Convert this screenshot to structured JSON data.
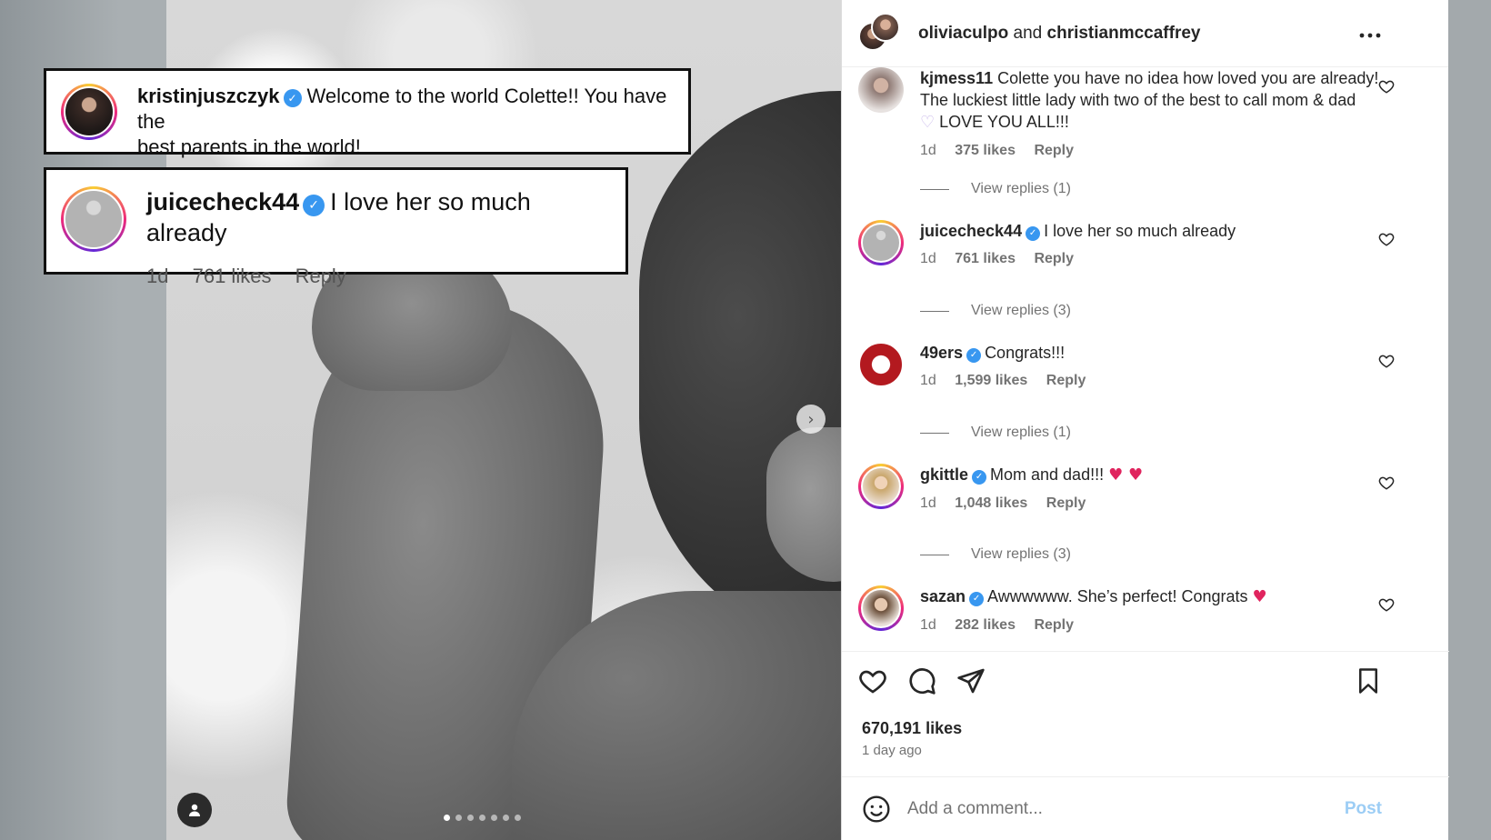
{
  "post": {
    "authors": {
      "user1": "oliviaculpo",
      "joiner": "and",
      "user2": "christianmccaffrey"
    },
    "more_icon": "more-horizontal-icon",
    "likes": "670,191 likes",
    "time_ago": "1 day ago",
    "carousel_count": 7,
    "carousel_active": 0
  },
  "callouts": [
    {
      "user": "kristinjuszczyk",
      "text": "Welcome to the world Colette!! You have the",
      "text2": "best parents in the world!"
    },
    {
      "user": "juicecheck44",
      "text": "I love her so much already",
      "time": "1d",
      "likes": "761 likes",
      "reply": "Reply"
    }
  ],
  "comments": [
    {
      "user": "kjmess11",
      "verified": false,
      "text": "Colette you have no idea how loved you are already! The luckiest little lady with two of the best to call mom & dad",
      "emoji": "♡",
      "text_after": " LOVE YOU ALL!!!",
      "time": "1d",
      "likes": "375 likes",
      "reply": "Reply",
      "view_replies": "View replies (1)"
    },
    {
      "user": "juicecheck44",
      "verified": true,
      "text": "I love her so much already",
      "time": "1d",
      "likes": "761 likes",
      "reply": "Reply",
      "view_replies": "View replies (3)"
    },
    {
      "user": "49ers",
      "verified": true,
      "text": "Congrats!!!",
      "time": "1d",
      "likes": "1,599 likes",
      "reply": "Reply",
      "view_replies": "View replies (1)"
    },
    {
      "user": "gkittle",
      "verified": true,
      "text": "Mom and dad!!!",
      "emoji": "♥ ♥",
      "time": "1d",
      "likes": "1,048 likes",
      "reply": "Reply",
      "view_replies": "View replies (3)"
    },
    {
      "user": "sazan",
      "verified": true,
      "text": "Awwwwww. She’s perfect! Congrats",
      "emoji": "♥",
      "time": "1d",
      "likes": "282 likes",
      "reply": "Reply"
    }
  ],
  "composer": {
    "placeholder": "Add a comment...",
    "post_label": "Post"
  },
  "icons": {
    "verified": "✓",
    "next": "›"
  },
  "colors": {
    "verified": "#3897f0",
    "heart": "#e0245e",
    "post_disabled": "#9ccdf5"
  }
}
